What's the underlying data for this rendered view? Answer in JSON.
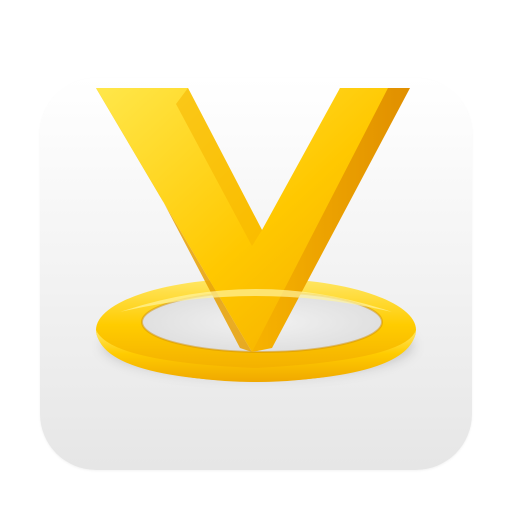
{
  "app_icon": {
    "icon": "yellow-v-location-pin-icon",
    "colors": {
      "tile_top": "#ffffff",
      "tile_bottom": "#e6e6e6",
      "accent_light": "#ffe14d",
      "accent": "#ffc400",
      "accent_dark": "#e39a00"
    }
  }
}
